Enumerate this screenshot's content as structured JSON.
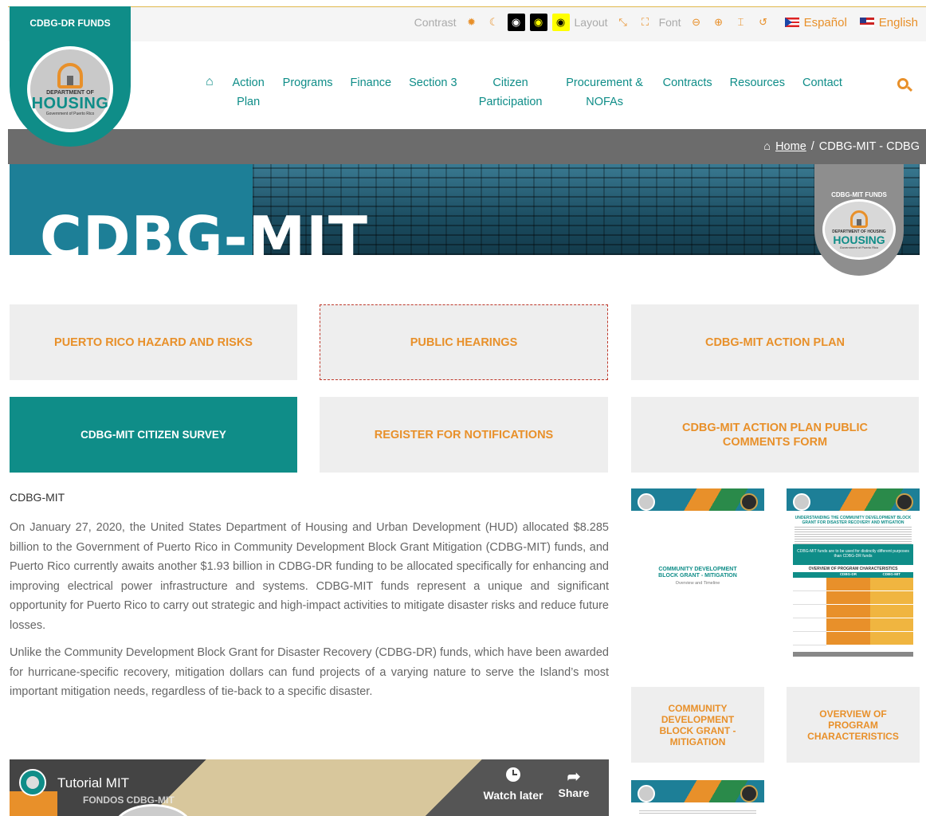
{
  "accessibility": {
    "contrast_label": "Contrast",
    "layout_label": "Layout",
    "font_label": "Font",
    "languages": [
      "Español",
      "English"
    ]
  },
  "logo": {
    "arc_text": "CDBG-DR FUNDS",
    "dept": "DEPARTMENT OF",
    "housing": "HOUSING",
    "gov": "Government of Puerto Rico"
  },
  "nav": {
    "items": [
      {
        "label": "Action Plan"
      },
      {
        "label": "Programs"
      },
      {
        "label": "Finance"
      },
      {
        "label": "Section 3"
      },
      {
        "label": "Citizen Participation"
      },
      {
        "label": "Procurement & NOFAs"
      },
      {
        "label": "Contracts"
      },
      {
        "label": "Resources"
      },
      {
        "label": "Contact"
      }
    ]
  },
  "breadcrumb": {
    "home": "Home",
    "separator": "/",
    "current": "CDBG-MIT - CDBG"
  },
  "banner": {
    "title": "CDBG-MIT",
    "badge_arc": "CDBG-MIT FUNDS",
    "badge_dept": "DEPARTMENT OF HOUSING",
    "badge_housing": "HOUSING",
    "badge_gov": "Government of Puerto Rico"
  },
  "tiles": [
    "PUERTO RICO HAZARD AND RISKS",
    "PUBLIC HEARINGS",
    "CDBG-MIT ACTION PLAN",
    "CDBG-MIT CITIZEN SURVEY",
    "REGISTER FOR NOTIFICATIONS",
    "CDBG-MIT ACTION PLAN PUBLIC COMMENTS FORM"
  ],
  "article": {
    "heading": "CDBG-MIT",
    "p1": "On January 27, 2020, the United States Department of Housing and Urban Development (HUD) allocated $8.285 billion to the Government of Puerto Rico in Community Development Block Grant Mitigation (CDBG-MIT) funds, and Puerto Rico currently awaits another $1.93 billion in CDBG-DR funding to be allocated specifically for enhancing and improving electrical power infrastructure and systems. CDBG-MIT funds represent a unique and significant opportunity for Puerto Rico to carry out strategic and high-impact activities to mitigate disaster risks and reduce future losses.",
    "p2": "Unlike the Community Development Block Grant for Disaster Recovery (CDBG-DR) funds, which have been awarded for hurricane-specific recovery, mitigation dollars can fund projects of a varying nature to serve the Island’s most important mitigation needs, regardless of tie-back to a specific disaster."
  },
  "video": {
    "title": "Tutorial MIT",
    "watermark": "FONDOS CDBG-MIT",
    "watch_later": "Watch later",
    "share": "Share"
  },
  "documents": {
    "doc1_title": "COMMUNITY DEVELOPMENT BLOCK GRANT - MITIGATION",
    "doc1_sub": "Overview and Timeline",
    "doc2_heading": "UNDERSTANDING THE COMMUNITY DEVELOPMENT BLOCK GRANT FOR DISASTER RECOVERY AND MITIGATION",
    "doc2_quote": "CDBG-MIT funds are to be used for distinctly different purposes than CDBG-DR funds",
    "doc2_table_title": "OVERVIEW OF PROGRAM CHARACTERISTICS",
    "doc2_col1": "CDBG-DR",
    "doc2_col2": "CDBG-MIT",
    "tile1": "COMMUNITY DEVELOPMENT BLOCK GRANT - MITIGATION",
    "tile2": "OVERVIEW OF PROGRAM CHARACTERISTICS"
  }
}
